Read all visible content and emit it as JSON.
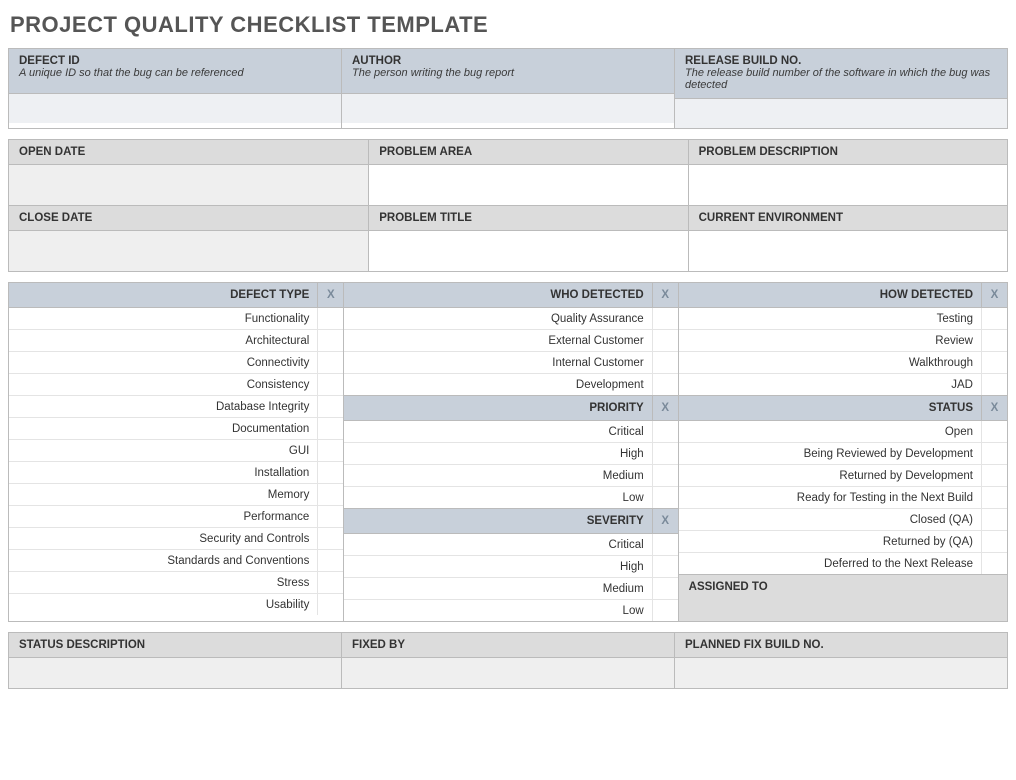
{
  "title": "PROJECT QUALITY CHECKLIST TEMPLATE",
  "header": {
    "defect_id": {
      "label": "DEFECT ID",
      "desc": "A unique ID so that the bug can be referenced"
    },
    "author": {
      "label": "AUTHOR",
      "desc": "The person writing the bug report"
    },
    "release_build": {
      "label": "RELEASE BUILD NO.",
      "desc": "The release build number of the software in which the bug was detected"
    }
  },
  "grid": {
    "open_date": "OPEN DATE",
    "problem_area": "PROBLEM AREA",
    "problem_description": "PROBLEM DESCRIPTION",
    "close_date": "CLOSE DATE",
    "problem_title": "PROBLEM TITLE",
    "current_environment": "CURRENT ENVIRONMENT"
  },
  "checkmark": "X",
  "defect_type": {
    "label": "DEFECT TYPE",
    "items": [
      "Functionality",
      "Architectural",
      "Connectivity",
      "Consistency",
      "Database Integrity",
      "Documentation",
      "GUI",
      "Installation",
      "Memory",
      "Performance",
      "Security and Controls",
      "Standards and Conventions",
      "Stress",
      "Usability"
    ]
  },
  "who_detected": {
    "label": "WHO DETECTED",
    "items": [
      "Quality Assurance",
      "External Customer",
      "Internal Customer",
      "Development"
    ]
  },
  "priority": {
    "label": "PRIORITY",
    "items": [
      "Critical",
      "High",
      "Medium",
      "Low"
    ]
  },
  "severity": {
    "label": "SEVERITY",
    "items": [
      "Critical",
      "High",
      "Medium",
      "Low"
    ]
  },
  "how_detected": {
    "label": "HOW DETECTED",
    "items": [
      "Testing",
      "Review",
      "Walkthrough",
      "JAD"
    ]
  },
  "status": {
    "label": "STATUS",
    "items": [
      "Open",
      "Being Reviewed by Development",
      "Returned by Development",
      "Ready for Testing in the Next Build",
      "Closed (QA)",
      "Returned by (QA)",
      "Deferred to the Next Release"
    ]
  },
  "assigned_to": "ASSIGNED TO",
  "footer": {
    "status_description": "STATUS DESCRIPTION",
    "fixed_by": "FIXED BY",
    "planned_fix": "PLANNED FIX BUILD NO."
  }
}
